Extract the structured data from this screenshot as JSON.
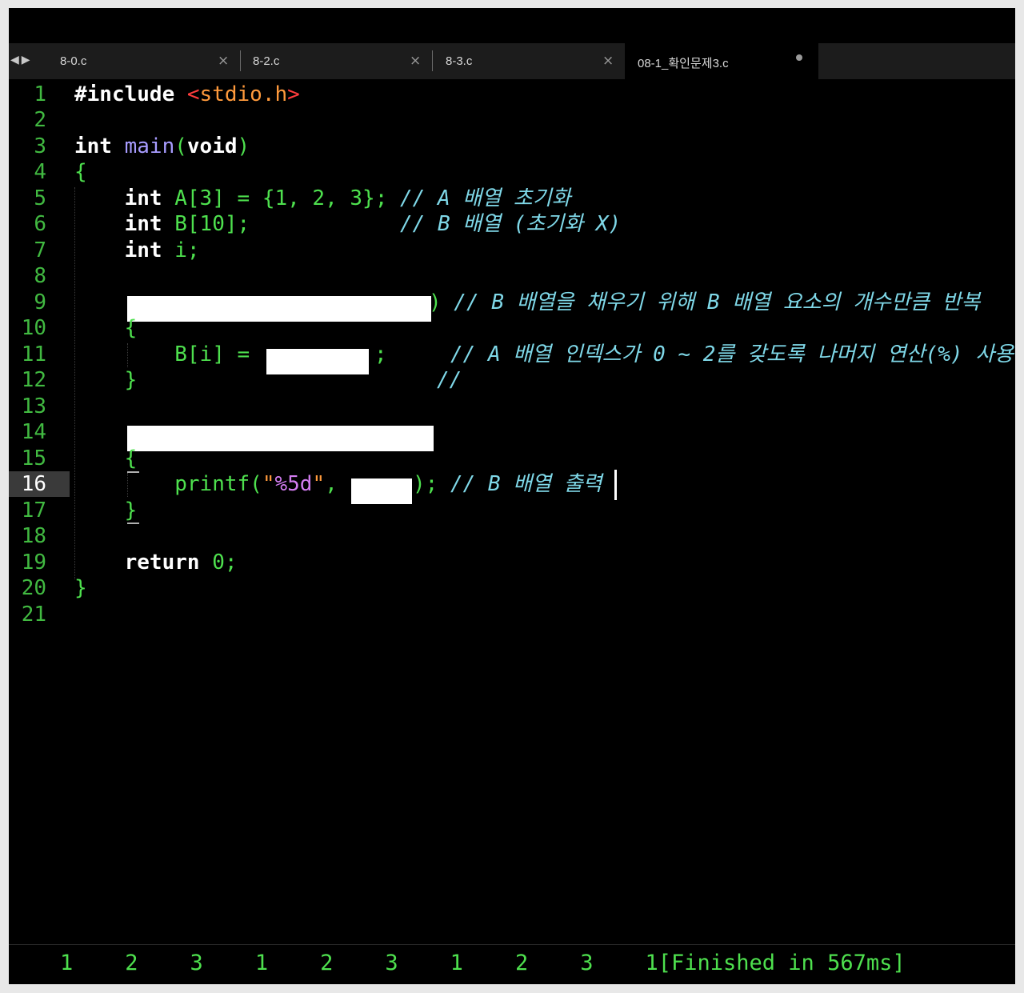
{
  "tabs": [
    {
      "label": "8-0.c",
      "state": "close",
      "close_icon": "×"
    },
    {
      "label": "8-2.c",
      "state": "close",
      "close_icon": "×"
    },
    {
      "label": "8-3.c",
      "state": "close",
      "close_icon": "×"
    },
    {
      "label": "08-1_확인문제3.c",
      "state": "modified",
      "active": true
    }
  ],
  "nav": {
    "back": "◀",
    "forward": "▶"
  },
  "editor": {
    "current_line": 16,
    "line_numbers": [
      "1",
      "2",
      "3",
      "4",
      "5",
      "6",
      "7",
      "8",
      "9",
      "10",
      "11",
      "12",
      "13",
      "14",
      "15",
      "16",
      "17",
      "18",
      "19",
      "20",
      "21"
    ],
    "lines": {
      "l1": {
        "a": "#include ",
        "b": "<",
        "c": "stdio.h",
        "d": ">"
      },
      "l3": {
        "a": "int",
        "b": " ",
        "c": "main",
        "d": "(",
        "e": "void",
        "f": ")"
      },
      "l4": {
        "a": "{"
      },
      "l5": {
        "ind": "    ",
        "a": "int",
        "b": " A[3] = {1, 2, 3}; ",
        "c": "// A 배열 초기화"
      },
      "l6": {
        "ind": "    ",
        "a": "int",
        "b": " B[10];            ",
        "c": "// B 배열 (초기화 X)"
      },
      "l7": {
        "ind": "    ",
        "a": "int",
        "b": " i;"
      },
      "l9": {
        "a": ")",
        "c": " // B 배열을 채우기 위해 B 배열 요소의 개수만큼 반복"
      },
      "l10": {
        "ind": "    ",
        "a": "{"
      },
      "l11": {
        "ind": "        ",
        "a": "B[i] = ",
        "b": ";",
        "c": "// A 배열 인덱스가 0 ~ 2를 갖도록 나머지 연산(%) 사용"
      },
      "l12": {
        "ind": "    ",
        "a": "}",
        "c": "//"
      },
      "l15": {
        "ind": "    ",
        "a": "{"
      },
      "l16": {
        "ind": "        ",
        "a": "printf(",
        "b": "\"",
        "c": "%5d",
        "d": "\"",
        "e": ",",
        "f": "); ",
        "g": "// B 배열 출력"
      },
      "l17": {
        "ind": "    ",
        "a": "}"
      },
      "l19": {
        "ind": "    ",
        "a": "return",
        "b": " 0;"
      },
      "l20": {
        "a": "}"
      }
    }
  },
  "output": {
    "text": "1    2    3    1    2    3    1    2    3    1[Finished in 567ms]"
  },
  "colors": {
    "background": "#000000",
    "line_numbers": "#41b941",
    "code_default": "#4ee04e",
    "keyword": "#ffffff",
    "function": "#a89cff",
    "string": "#ff9a3c",
    "comment": "#7fd8e8"
  }
}
